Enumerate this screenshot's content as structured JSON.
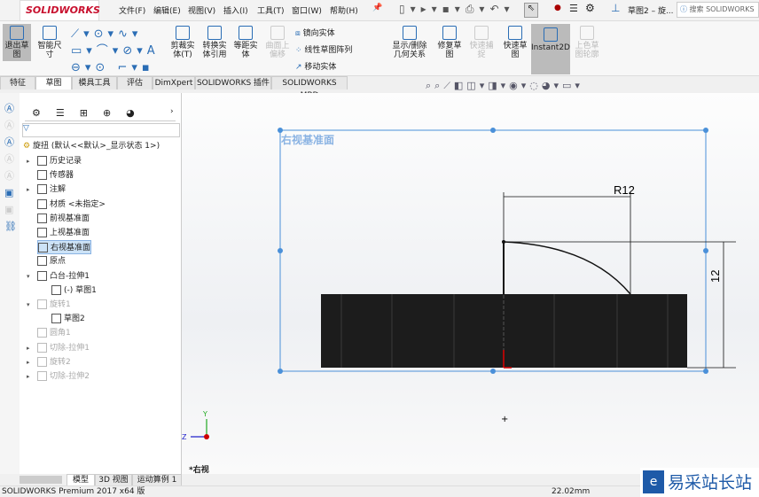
{
  "app": {
    "logo": "SOLIDWORKS",
    "doc_title": "草图2 – 旋...",
    "search_placeholder": "搜索 SOLIDWORKS"
  },
  "menu": [
    "文件(F)",
    "编辑(E)",
    "视图(V)",
    "插入(I)",
    "工具(T)",
    "窗口(W)",
    "帮助(H)"
  ],
  "ribbon": {
    "exit_sketch": "退出草图",
    "smart_dim": "智能尺寸",
    "trim": "剪裁实体(T)",
    "convert": "转换实体引用",
    "offset": "等距实体",
    "surface_offset": "曲面上偏移",
    "mirror": "镜向实体",
    "linear_pattern": "线性草图阵列",
    "move": "移动实体",
    "show_relations": "显示/删除几何关系",
    "repair": "修复草图",
    "quick_snap": "快速捕捉",
    "rapid_sketch": "快速草图",
    "instant2d": "Instant2D",
    "shaded_contours": "上色草图轮廓"
  },
  "tabs": [
    "特征",
    "草图",
    "模具工具",
    "评估",
    "DimXpert",
    "SOLIDWORKS 插件",
    "SOLIDWORKS MBD"
  ],
  "active_tab": "草图",
  "tree": {
    "root": "旋扭 (默认<<默认>_显示状态 1>)",
    "items": [
      "历史记录",
      "传感器",
      "注解",
      "材质 <未指定>",
      "前视基准面",
      "上视基准面",
      "右视基准面",
      "原点",
      "凸台-拉伸1",
      "(-) 草图1",
      "旋转1",
      "草图2",
      "圆角1",
      "切除-拉伸1",
      "旋转2",
      "切除-拉伸2"
    ],
    "selected": "右视基准面"
  },
  "viewport": {
    "plane_label": "右视基准面",
    "dim_radius": "R12",
    "dim_height": "12",
    "view_name": "*右视",
    "triad": {
      "y": "Y",
      "z": "Z"
    }
  },
  "bottom_tabs": [
    "模型",
    "3D 视图",
    "运动算例 1"
  ],
  "status": {
    "product": "SOLIDWORKS Premium 2017 x64 版",
    "measure": "22.02mm"
  },
  "watermark": "易采站长站",
  "colors": {
    "accent": "#2a6db5",
    "logo": "#c8102e",
    "plane": "#4a90d9",
    "body": "#1a1a1a"
  }
}
